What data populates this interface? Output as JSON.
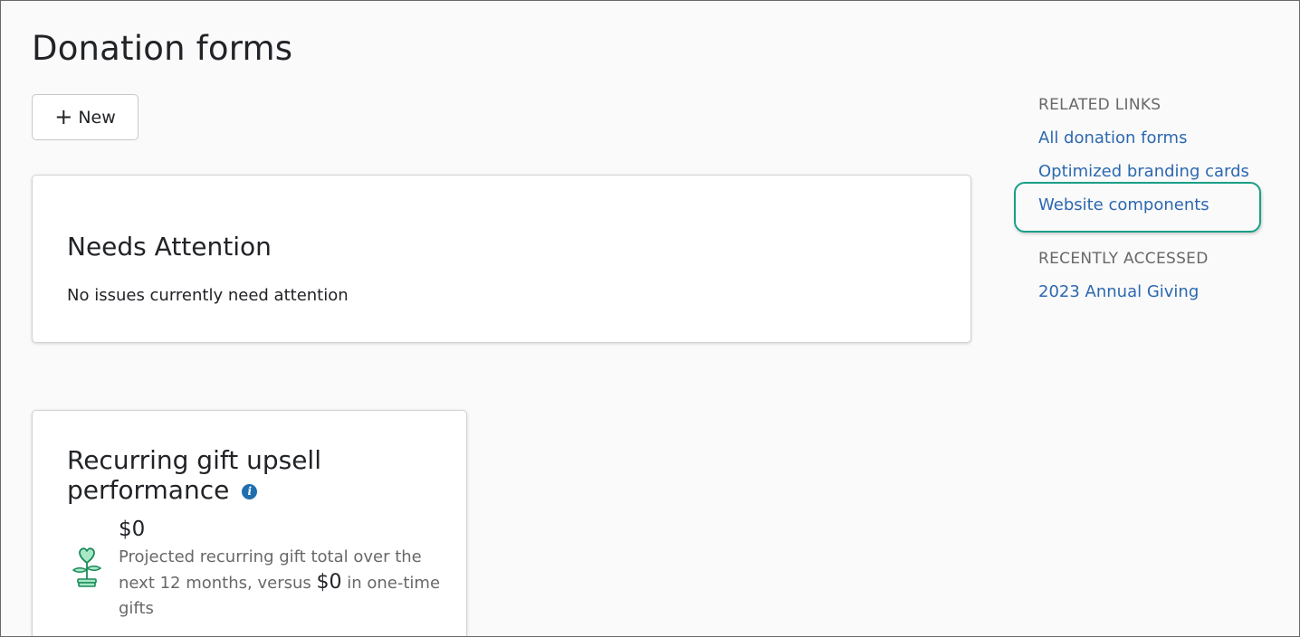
{
  "page": {
    "title": "Donation forms",
    "new_button": {
      "icon": "plus-icon",
      "label": "New"
    }
  },
  "needs_attention": {
    "title": "Needs Attention",
    "message": "No issues currently need attention"
  },
  "recurring_gift": {
    "title": "Recurring gift upsell performance",
    "info_icon": "info-icon",
    "metric_icon": "heart-plant-icon",
    "value": "$0",
    "description_before": "Projected recurring gift total over the next 12 months, versus",
    "one_time_amount": "$0",
    "description_after": "in one-time gifts"
  },
  "sidebar": {
    "related_links_heading": "RELATED LINKS",
    "related_links": [
      {
        "label": "All donation forms"
      },
      {
        "label": "Optimized branding cards"
      },
      {
        "label": "Website components",
        "highlighted": true
      }
    ],
    "recently_accessed_heading": "RECENTLY ACCESSED",
    "recently_accessed": [
      {
        "label": "2023 Annual Giving"
      }
    ]
  },
  "colors": {
    "link": "#2c68b0",
    "highlight_ring": "#1a9e87",
    "info_icon": "#1f6fae",
    "plant_icon": "#2db37a"
  }
}
